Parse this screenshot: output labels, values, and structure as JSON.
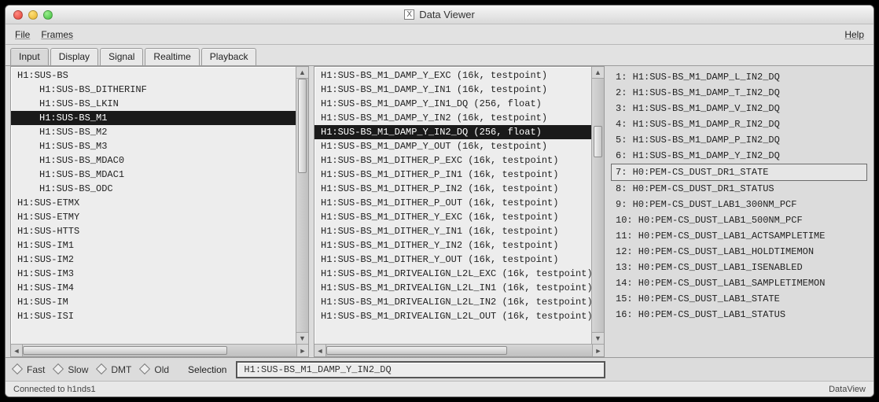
{
  "window": {
    "title": "Data Viewer"
  },
  "menu": {
    "file": "File",
    "frames": "Frames",
    "help": "Help"
  },
  "tabs": [
    {
      "label": "Input",
      "active": true
    },
    {
      "label": "Display"
    },
    {
      "label": "Signal"
    },
    {
      "label": "Realtime"
    },
    {
      "label": "Playback"
    }
  ],
  "left_list": [
    {
      "text": "H1:SUS-BS"
    },
    {
      "text": "H1:SUS-BS_DITHERINF",
      "indent": true
    },
    {
      "text": "H1:SUS-BS_LKIN",
      "indent": true
    },
    {
      "text": "H1:SUS-BS_M1",
      "indent": true,
      "selected": true
    },
    {
      "text": "H1:SUS-BS_M2",
      "indent": true
    },
    {
      "text": "H1:SUS-BS_M3",
      "indent": true
    },
    {
      "text": "H1:SUS-BS_MDAC0",
      "indent": true
    },
    {
      "text": "H1:SUS-BS_MDAC1",
      "indent": true
    },
    {
      "text": "H1:SUS-BS_ODC",
      "indent": true
    },
    {
      "text": "H1:SUS-ETMX"
    },
    {
      "text": "H1:SUS-ETMY"
    },
    {
      "text": "H1:SUS-HTTS"
    },
    {
      "text": "H1:SUS-IM1"
    },
    {
      "text": "H1:SUS-IM2"
    },
    {
      "text": "H1:SUS-IM3"
    },
    {
      "text": "H1:SUS-IM4"
    },
    {
      "text": "H1:SUS-IM"
    },
    {
      "text": "H1:SUS-ISI"
    }
  ],
  "mid_list": [
    {
      "text": "H1:SUS-BS_M1_DAMP_Y_EXC   (16k, testpoint)"
    },
    {
      "text": "H1:SUS-BS_M1_DAMP_Y_IN1   (16k, testpoint)"
    },
    {
      "text": "H1:SUS-BS_M1_DAMP_Y_IN1_DQ   (256, float)"
    },
    {
      "text": "H1:SUS-BS_M1_DAMP_Y_IN2   (16k, testpoint)"
    },
    {
      "text": "H1:SUS-BS_M1_DAMP_Y_IN2_DQ   (256, float)",
      "selected": true
    },
    {
      "text": "H1:SUS-BS_M1_DAMP_Y_OUT   (16k, testpoint)"
    },
    {
      "text": "H1:SUS-BS_M1_DITHER_P_EXC   (16k, testpoint)"
    },
    {
      "text": "H1:SUS-BS_M1_DITHER_P_IN1   (16k, testpoint)"
    },
    {
      "text": "H1:SUS-BS_M1_DITHER_P_IN2   (16k, testpoint)"
    },
    {
      "text": "H1:SUS-BS_M1_DITHER_P_OUT   (16k, testpoint)"
    },
    {
      "text": "H1:SUS-BS_M1_DITHER_Y_EXC   (16k, testpoint)"
    },
    {
      "text": "H1:SUS-BS_M1_DITHER_Y_IN1   (16k, testpoint)"
    },
    {
      "text": "H1:SUS-BS_M1_DITHER_Y_IN2   (16k, testpoint)"
    },
    {
      "text": "H1:SUS-BS_M1_DITHER_Y_OUT   (16k, testpoint)"
    },
    {
      "text": "H1:SUS-BS_M1_DRIVEALIGN_L2L_EXC   (16k, testpoint)"
    },
    {
      "text": "H1:SUS-BS_M1_DRIVEALIGN_L2L_IN1   (16k, testpoint)"
    },
    {
      "text": "H1:SUS-BS_M1_DRIVEALIGN_L2L_IN2   (16k, testpoint)"
    },
    {
      "text": "H1:SUS-BS_M1_DRIVEALIGN_L2L_OUT   (16k, testpoint)"
    }
  ],
  "right_list": [
    {
      "text": "1: H1:SUS-BS_M1_DAMP_L_IN2_DQ"
    },
    {
      "text": "2: H1:SUS-BS_M1_DAMP_T_IN2_DQ"
    },
    {
      "text": "3: H1:SUS-BS_M1_DAMP_V_IN2_DQ"
    },
    {
      "text": "4: H1:SUS-BS_M1_DAMP_R_IN2_DQ"
    },
    {
      "text": "5: H1:SUS-BS_M1_DAMP_P_IN2_DQ"
    },
    {
      "text": "6: H1:SUS-BS_M1_DAMP_Y_IN2_DQ"
    },
    {
      "text": "7: H0:PEM-CS_DUST_DR1_STATE",
      "selected": true
    },
    {
      "text": "8: H0:PEM-CS_DUST_DR1_STATUS"
    },
    {
      "text": "9: H0:PEM-CS_DUST_LAB1_300NM_PCF"
    },
    {
      "text": "10: H0:PEM-CS_DUST_LAB1_500NM_PCF"
    },
    {
      "text": "11: H0:PEM-CS_DUST_LAB1_ACTSAMPLETIME"
    },
    {
      "text": "12: H0:PEM-CS_DUST_LAB1_HOLDTIMEMON"
    },
    {
      "text": "13: H0:PEM-CS_DUST_LAB1_ISENABLED"
    },
    {
      "text": "14: H0:PEM-CS_DUST_LAB1_SAMPLETIMEMON"
    },
    {
      "text": "15: H0:PEM-CS_DUST_LAB1_STATE"
    },
    {
      "text": "16: H0:PEM-CS_DUST_LAB1_STATUS"
    }
  ],
  "bottom": {
    "fast": "Fast",
    "slow": "Slow",
    "dmt": "DMT",
    "old": "Old",
    "selection_label": "Selection",
    "selection_value": "H1:SUS-BS_M1_DAMP_Y_IN2_DQ"
  },
  "status": {
    "left": "Connected to h1nds1",
    "right": "DataView"
  }
}
